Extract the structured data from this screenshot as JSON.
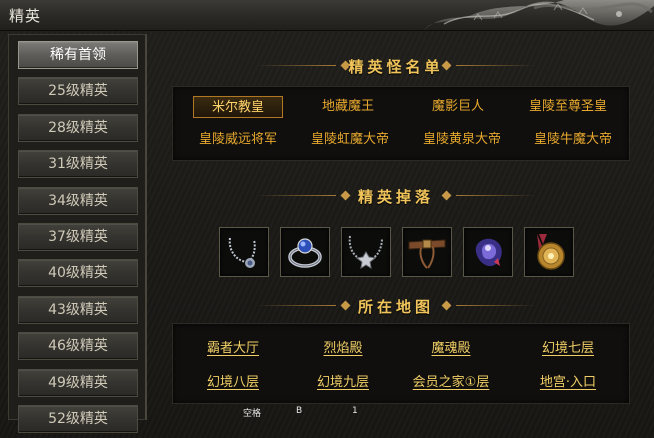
{
  "window": {
    "title": "精英"
  },
  "sidebar": {
    "items": [
      {
        "label": "稀有首领",
        "active": true
      },
      {
        "label": "25级精英"
      },
      {
        "label": "28级精英"
      },
      {
        "label": "31级精英"
      },
      {
        "label": "34级精英"
      },
      {
        "label": "37级精英"
      },
      {
        "label": "40级精英"
      },
      {
        "label": "43级精英"
      },
      {
        "label": "46级精英"
      },
      {
        "label": "49级精英"
      },
      {
        "label": "52级精英"
      }
    ]
  },
  "sections": {
    "bosses_title": "精英怪名单",
    "drops_title": "精英掉落",
    "maps_title": "所在地图"
  },
  "bosses": [
    {
      "name": "米尔教皇",
      "selected": true
    },
    {
      "name": "地藏魔王"
    },
    {
      "name": "魔影巨人"
    },
    {
      "name": "皇陵至尊圣皇"
    },
    {
      "name": "皇陵威远将军"
    },
    {
      "name": "皇陵虹魔大帝"
    },
    {
      "name": "皇陵黄泉大帝"
    },
    {
      "name": "皇陵牛魔大帝"
    }
  ],
  "drops": [
    {
      "icon": "silver-necklace-icon"
    },
    {
      "icon": "sapphire-ring-icon"
    },
    {
      "icon": "spiked-necklace-icon"
    },
    {
      "icon": "leather-belt-icon"
    },
    {
      "icon": "purple-gem-icon"
    },
    {
      "icon": "gold-medal-icon"
    }
  ],
  "maps": [
    {
      "name": "霸者大厅"
    },
    {
      "name": "烈焰殿"
    },
    {
      "name": "魔魂殿"
    },
    {
      "name": "幻境七层"
    },
    {
      "name": "幻境八层"
    },
    {
      "name": "幻境九层"
    },
    {
      "name": "会员之家①层"
    },
    {
      "name": "地宫·入口"
    }
  ],
  "statusbar": {
    "space_label": "空格",
    "b_label": "B",
    "num_label": "1"
  },
  "colors": {
    "accent_gold": "#f0c45a",
    "boss_orange": "#e8a92e",
    "map_yellow": "#f1cf66",
    "selected_border": "#b07822"
  }
}
